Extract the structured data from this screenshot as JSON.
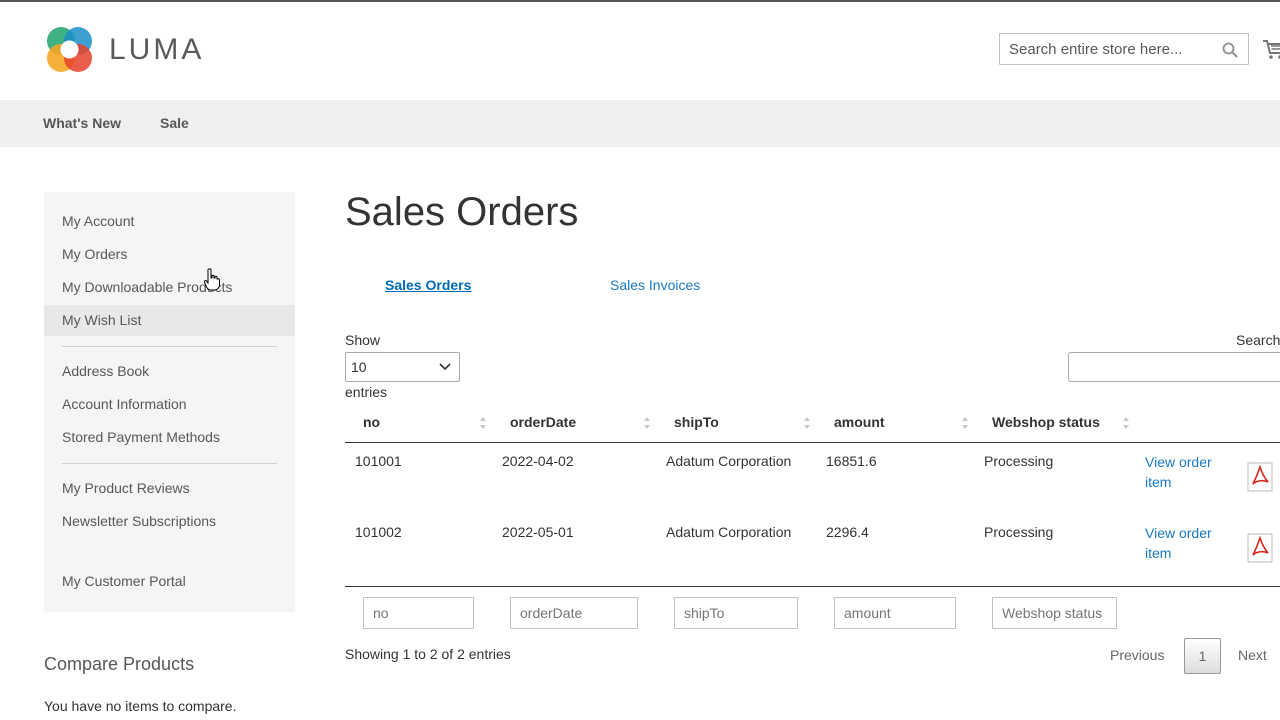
{
  "header": {
    "logo_text": "LUMA",
    "search_placeholder": "Search entire store here..."
  },
  "nav": {
    "items": [
      "What's New",
      "Sale"
    ]
  },
  "sidebar": {
    "group1": [
      "My Account",
      "My Orders",
      "My Downloadable Products",
      "My Wish List"
    ],
    "group2": [
      "Address Book",
      "Account Information",
      "Stored Payment Methods"
    ],
    "group3": [
      "My Product Reviews",
      "Newsletter Subscriptions"
    ],
    "group4": [
      "My Customer Portal"
    ],
    "highlighted": "My Wish List"
  },
  "compare": {
    "title": "Compare Products",
    "text": "You have no items to compare."
  },
  "main": {
    "title": "Sales Orders",
    "tabs": [
      {
        "label": "Sales Orders",
        "active": true
      },
      {
        "label": "Sales Invoices",
        "active": false
      }
    ],
    "show_label": "Show",
    "length_value": "10",
    "entries_label": "entries",
    "search_label": "Search",
    "columns": [
      "no",
      "orderDate",
      "shipTo",
      "amount",
      "Webshop status"
    ],
    "rows": [
      {
        "no": "101001",
        "orderDate": "2022-04-02",
        "shipTo": "Adatum Corporation",
        "amount": "16851.6",
        "status": "Processing",
        "link": "View order item"
      },
      {
        "no": "101002",
        "orderDate": "2022-05-01",
        "shipTo": "Adatum Corporation",
        "amount": "2296.4",
        "status": "Processing",
        "link": "View order item"
      }
    ],
    "filters": [
      "no",
      "orderDate",
      "shipTo",
      "amount",
      "Webshop status"
    ],
    "info": "Showing 1 to 2 of 2 entries",
    "pagination": {
      "previous": "Previous",
      "current": "1",
      "next": "Next"
    }
  },
  "colors": {
    "link": "#1979c3",
    "nav_bg": "#f0f0f0",
    "sidebar_bg": "#f5f5f5",
    "pdf_red": "#d7241b"
  }
}
